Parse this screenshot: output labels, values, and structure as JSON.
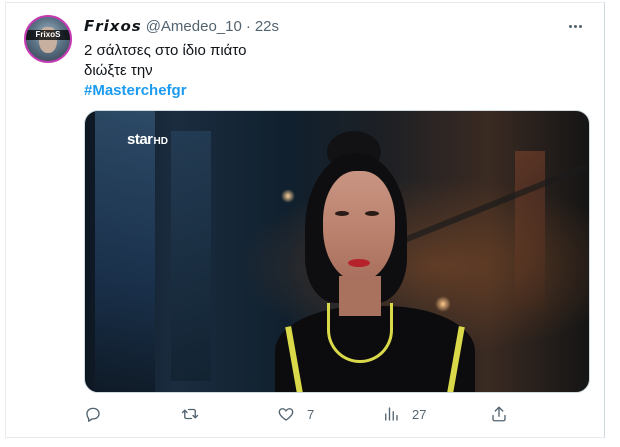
{
  "tweet": {
    "author": {
      "display_name": "𝙁𝙧𝙞𝙭𝙤𝙨",
      "handle": "@Amedeo_10",
      "time": "22s",
      "avatar_label": "FrixoS"
    },
    "separator": "·",
    "text_lines": [
      "2 σάλτσες στο ίδιο πιάτο",
      "διώξτε την"
    ],
    "hashtag": "#Masterchefgr",
    "media": {
      "logo_star": "star",
      "logo_hd": "HD"
    },
    "actions": {
      "reply_icon": "reply-icon",
      "retweet_icon": "retweet-icon",
      "like_icon": "heart-icon",
      "like_count": "7",
      "views_icon": "views-icon",
      "views_count": "27",
      "share_icon": "share-icon"
    }
  }
}
